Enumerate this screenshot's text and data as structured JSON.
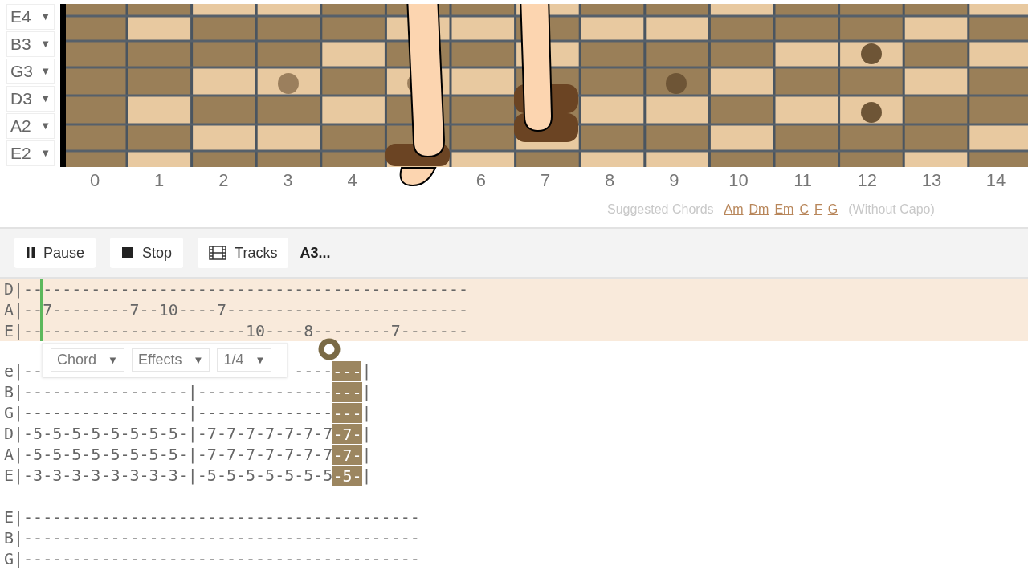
{
  "tuners": [
    {
      "label": "E4",
      "caret": "▼"
    },
    {
      "label": "B3",
      "caret": "▼"
    },
    {
      "label": "G3",
      "caret": "▼"
    },
    {
      "label": "D3",
      "caret": "▼"
    },
    {
      "label": "A2",
      "caret": "▼"
    },
    {
      "label": "E2",
      "caret": "▼"
    }
  ],
  "fret_labels": [
    {
      "kind": "label",
      "label": "0"
    },
    {
      "kind": "label",
      "label": "1"
    },
    {
      "kind": "label",
      "label": "2"
    },
    {
      "kind": "label",
      "label": "3"
    },
    {
      "kind": "label",
      "label": "4"
    },
    {
      "kind": "covered"
    },
    {
      "kind": "label",
      "label": "6"
    },
    {
      "kind": "label",
      "label": "7"
    },
    {
      "kind": "label",
      "label": "8"
    },
    {
      "kind": "label",
      "label": "9"
    },
    {
      "kind": "label",
      "label": "10"
    },
    {
      "kind": "label",
      "label": "11"
    },
    {
      "kind": "label",
      "label": "12"
    },
    {
      "kind": "label",
      "label": "13"
    },
    {
      "kind": "label",
      "label": "14"
    }
  ],
  "suggested_chords": {
    "label": "Suggested Chords",
    "chords": [
      "Am",
      "Dm",
      "Em",
      "C",
      "F",
      "G"
    ],
    "note": "(Without Capo)"
  },
  "toolbar": {
    "buttons": [
      {
        "kind": "pause",
        "label": "Pause"
      },
      {
        "kind": "stop",
        "label": "Stop"
      },
      {
        "kind": "tracks",
        "label": "Tracks"
      }
    ],
    "track_name": "A3..."
  },
  "tab_blocks": [
    {
      "playing": true,
      "lines": [
        {
          "segments": [
            {
              "kind": "text",
              "text": "D|----------------------------------------------",
              "highlight": false
            }
          ]
        },
        {
          "segments": [
            {
              "kind": "text",
              "text": "A|--7--------7--10----7-------------------------",
              "highlight": false
            }
          ]
        },
        {
          "segments": [
            {
              "kind": "text",
              "text": "E|-----------------------10----8--------7-------",
              "highlight": false
            }
          ]
        }
      ]
    },
    {
      "playing": false,
      "lines": [
        {
          "segments": [
            {
              "kind": "text",
              "text": "e|--",
              "highlight": false
            },
            {
              "kind": "covered"
            },
            {
              "kind": "text",
              "text": "----",
              "highlight": false
            },
            {
              "kind": "text",
              "text": "---",
              "highlight": true
            },
            {
              "kind": "text",
              "text": "|",
              "highlight": false
            }
          ]
        },
        {
          "segments": [
            {
              "kind": "text",
              "text": "B|-----------------|--------------",
              "highlight": false
            },
            {
              "kind": "text",
              "text": "---",
              "highlight": true
            },
            {
              "kind": "text",
              "text": "|",
              "highlight": false
            }
          ]
        },
        {
          "segments": [
            {
              "kind": "text",
              "text": "G|-----------------|--------------",
              "highlight": false
            },
            {
              "kind": "text",
              "text": "---",
              "highlight": true
            },
            {
              "kind": "text",
              "text": "|",
              "highlight": false
            }
          ]
        },
        {
          "segments": [
            {
              "kind": "text",
              "text": "D|-5-5-5-5-5-5-5-5-|-7-7-7-7-7-7-7",
              "highlight": false
            },
            {
              "kind": "text",
              "text": "-7-",
              "highlight": true
            },
            {
              "kind": "text",
              "text": "|",
              "highlight": false
            }
          ]
        },
        {
          "segments": [
            {
              "kind": "text",
              "text": "A|-5-5-5-5-5-5-5-5-|-7-7-7-7-7-7-7",
              "highlight": false
            },
            {
              "kind": "text",
              "text": "-7-",
              "highlight": true
            },
            {
              "kind": "text",
              "text": "|",
              "highlight": false
            }
          ]
        },
        {
          "segments": [
            {
              "kind": "text",
              "text": "E|-3-3-3-3-3-3-3-3-|-5-5-5-5-5-5-5",
              "highlight": false
            },
            {
              "kind": "text",
              "text": "-5-",
              "highlight": true
            },
            {
              "kind": "text",
              "text": "|",
              "highlight": false
            }
          ]
        }
      ]
    },
    {
      "playing": false,
      "lines": [
        {
          "segments": [
            {
              "kind": "text",
              "text": "E|-----------------------------------------",
              "highlight": false
            }
          ]
        },
        {
          "segments": [
            {
              "kind": "text",
              "text": "B|-----------------------------------------",
              "highlight": false
            }
          ]
        },
        {
          "segments": [
            {
              "kind": "text",
              "text": "G|-----------------------------------------",
              "highlight": false
            }
          ]
        }
      ]
    }
  ],
  "note_popup": {
    "selects": [
      {
        "label": "Chord",
        "caret": "▼"
      },
      {
        "label": "Effects",
        "caret": "▼"
      },
      {
        "label": "1/4",
        "caret": "▼"
      }
    ]
  }
}
